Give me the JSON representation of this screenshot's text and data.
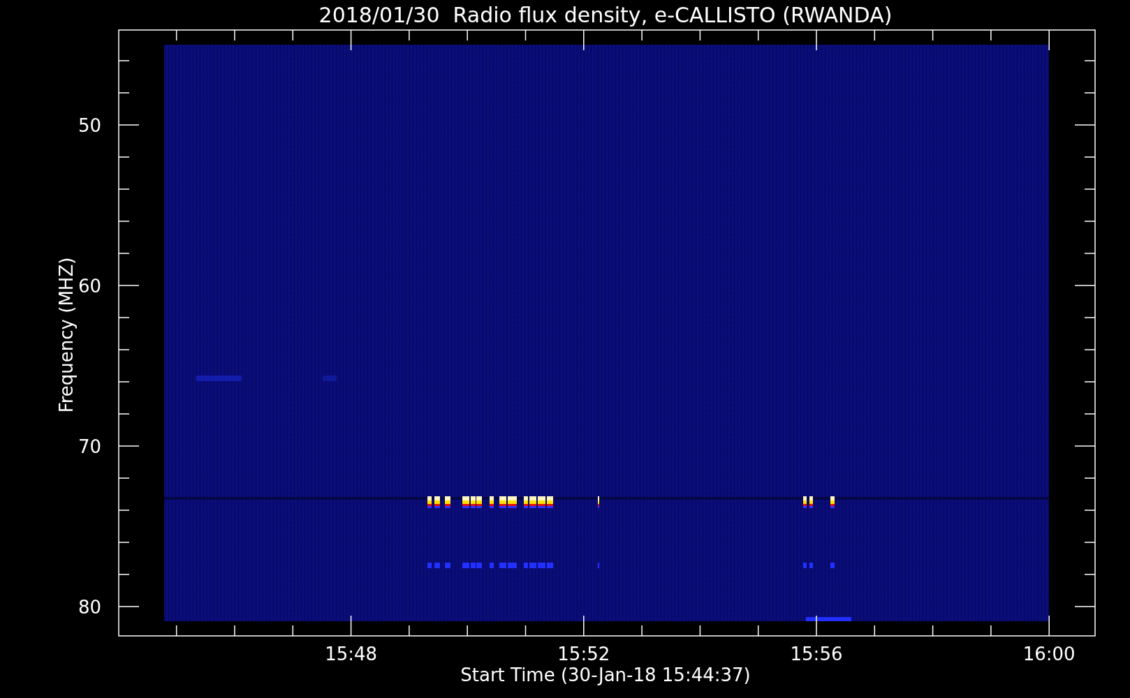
{
  "plot": {
    "title": "2018/01/30  Radio flux density, e-CALLISTO (RWANDA)",
    "xlabel": "Start Time (30-Jan-18 15:44:37)",
    "ylabel": "Frequency (MHZ)",
    "xticks": [
      "15:48",
      "15:52",
      "15:56",
      "16:00"
    ],
    "yticks": [
      "50",
      "60",
      "70",
      "80"
    ]
  }
}
